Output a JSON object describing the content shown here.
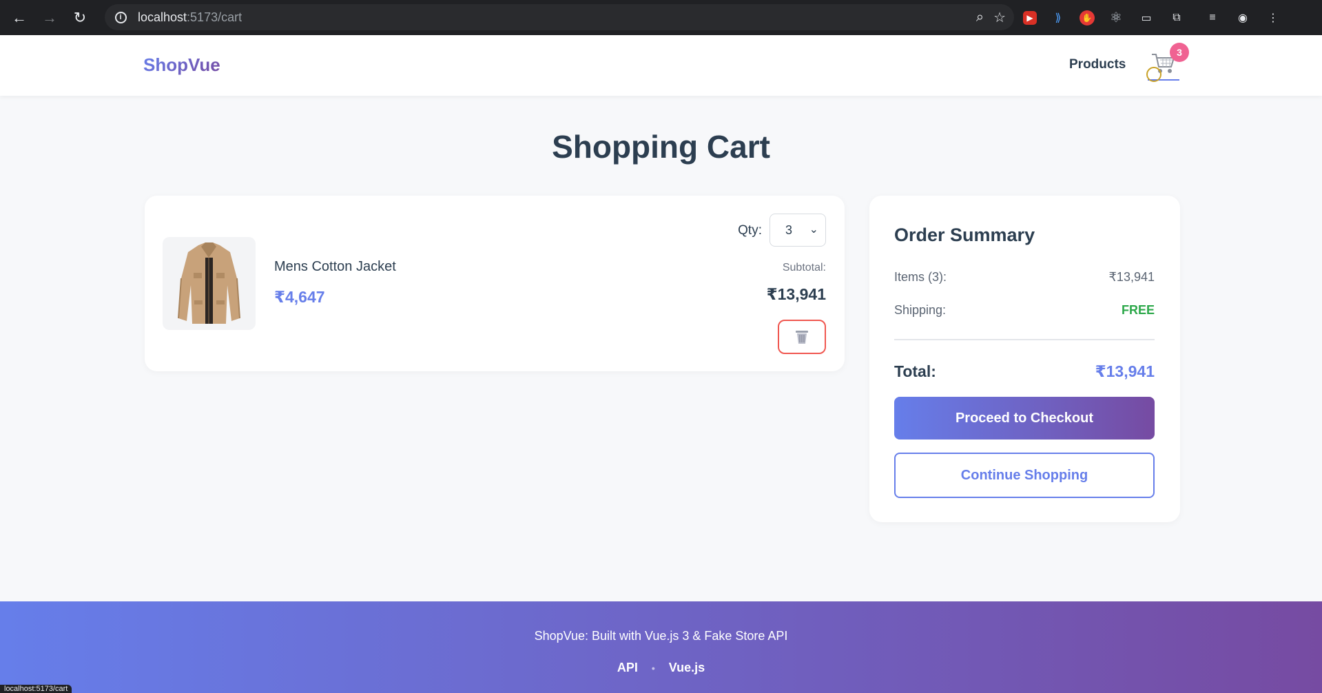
{
  "browser": {
    "url_host": "localhost",
    "url_rest": ":5173/cart",
    "extension_icons": [
      "back-icon",
      "forward-icon",
      "reload-icon",
      "site-info-icon",
      "zoom-icon",
      "bookmark-star-icon",
      "puzzle-icon",
      "reading-list-icon",
      "profile-icon",
      "menu-dots-icon"
    ],
    "status_url": "localhost:5173/cart"
  },
  "header": {
    "brand": "ShopVue",
    "nav_products": "Products",
    "cart_count": "3"
  },
  "page": {
    "title": "Shopping Cart"
  },
  "cart": {
    "items": [
      {
        "name": "Mens Cotton Jacket",
        "price": "₹4,647",
        "qty_label": "Qty:",
        "qty": "3",
        "subtotal_label": "Subtotal:",
        "subtotal": "₹13,941"
      }
    ]
  },
  "summary": {
    "title": "Order Summary",
    "items_label": "Items (3):",
    "items_value": "₹13,941",
    "shipping_label": "Shipping:",
    "shipping_value": "FREE",
    "total_label": "Total:",
    "total_value": "₹13,941",
    "checkout_button": "Proceed to Checkout",
    "continue_button": "Continue Shopping"
  },
  "footer": {
    "text": "ShopVue: Built with Vue.js 3 & Fake Store API",
    "link_api": "API",
    "separator": "•",
    "link_vue": "Vue.js"
  },
  "colors": {
    "brand_start": "#667eea",
    "brand_end": "#764ba2",
    "free": "#2ca84a",
    "remove_border": "#f0564f",
    "badge": "#f06292"
  }
}
